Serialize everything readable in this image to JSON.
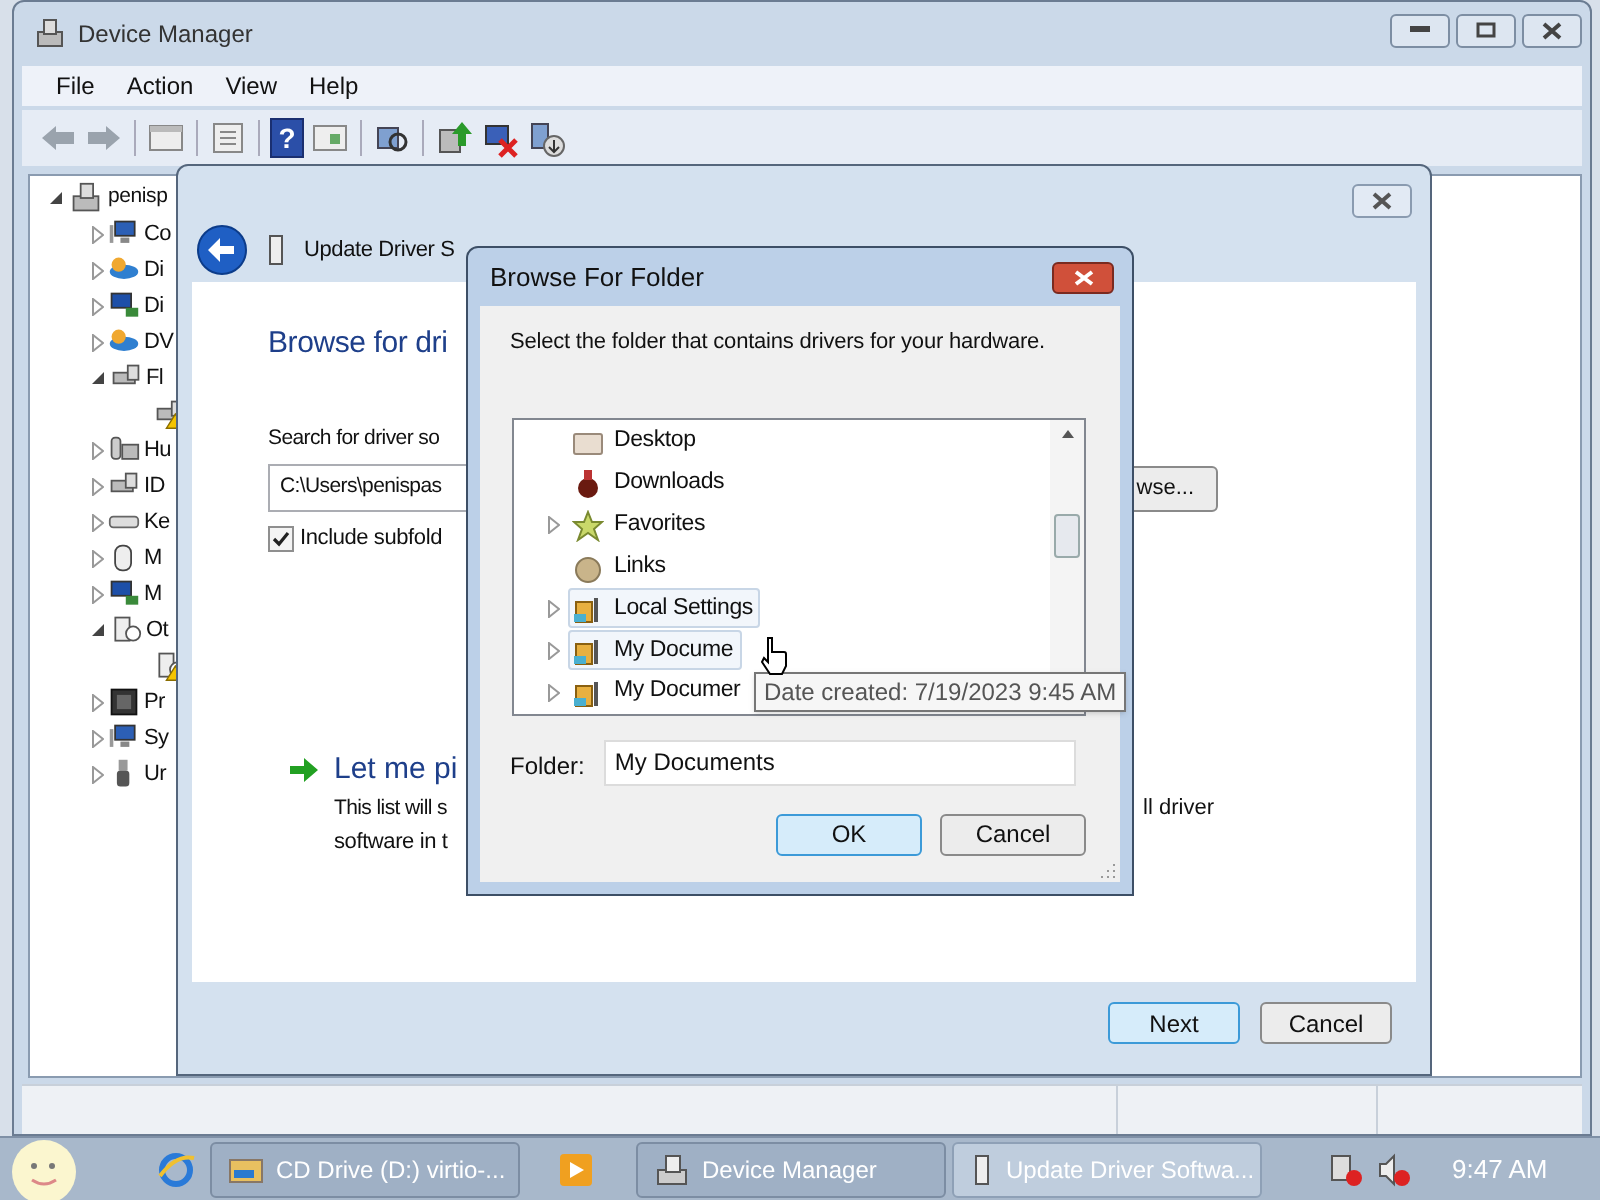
{
  "device_manager": {
    "title": "Device Manager",
    "menu": [
      "File",
      "Action",
      "View",
      "Help"
    ],
    "help_glyph": "?",
    "tree": {
      "label": "penisp",
      "expanded": true,
      "children": [
        {
          "label": "Co",
          "kind": "computer",
          "expanded": false
        },
        {
          "label": "Di",
          "kind": "drive",
          "expanded": false
        },
        {
          "label": "Di",
          "kind": "display",
          "expanded": false
        },
        {
          "label": "DV",
          "kind": "drive",
          "expanded": false
        },
        {
          "label": "Fl",
          "kind": "adapter",
          "expanded": true,
          "children": [
            {
              "kind": "adapter",
              "warning": true
            }
          ]
        },
        {
          "label": "Hu",
          "kind": "hid",
          "expanded": false
        },
        {
          "label": "ID",
          "kind": "adapter",
          "expanded": false
        },
        {
          "label": "Ke",
          "kind": "keyboard",
          "expanded": false
        },
        {
          "label": "M",
          "kind": "mouse",
          "expanded": false
        },
        {
          "label": "M",
          "kind": "display",
          "expanded": false
        },
        {
          "label": "Ot",
          "kind": "unknown",
          "expanded": true,
          "children": [
            {
              "kind": "unknown",
              "warning": true
            }
          ]
        },
        {
          "label": "Pr",
          "kind": "chip",
          "expanded": false
        },
        {
          "label": "Sy",
          "kind": "computer",
          "expanded": false
        },
        {
          "label": "Ur",
          "kind": "usb",
          "expanded": false
        }
      ]
    }
  },
  "update_driver": {
    "title": "Update Driver S",
    "heading": "Browse for dri",
    "search_label": "Search for driver so",
    "path": "C:\\Users\\penispas",
    "browse_button": "wse...",
    "include_subfolders": {
      "label": "Include subfold",
      "checked": true
    },
    "option": {
      "title": "Let me pi",
      "line_1": "This list will s",
      "line_1_end": "ll driver",
      "line_2": "software in t"
    },
    "buttons": [
      {
        "label": "Next",
        "default": true
      },
      {
        "label": "Cancel",
        "default": false
      }
    ]
  },
  "browse_dialog": {
    "title": "Browse For Folder",
    "prompt": "Select the folder that contains drivers for your hardware.",
    "folders": [
      {
        "label": "Desktop",
        "kind": "desktop",
        "expandable": false,
        "highlighted": false
      },
      {
        "label": "Downloads",
        "kind": "downloads",
        "expandable": false,
        "highlighted": false
      },
      {
        "label": "Favorites",
        "kind": "star",
        "expandable": true,
        "highlighted": false
      },
      {
        "label": "Links",
        "kind": "links",
        "expandable": false,
        "highlighted": false
      },
      {
        "label": "Local Settings",
        "kind": "user",
        "expandable": true,
        "highlighted": true
      },
      {
        "label": "My Docume",
        "kind": "user",
        "expandable": true,
        "highlighted": true
      },
      {
        "label": "My Documer",
        "kind": "user",
        "expandable": true,
        "highlighted": false
      }
    ],
    "tooltip": "Date created: 7/19/2023 9:45 AM",
    "folder_label": "Folder:",
    "folder_value": "My Documents",
    "buttons": [
      {
        "label": "OK",
        "default": true
      },
      {
        "label": "Cancel",
        "default": false
      }
    ]
  },
  "taskbar": {
    "tasks": [
      {
        "label": "CD Drive (D:) virtio-...",
        "kind": "folder",
        "active": false
      },
      {
        "label": "Device Manager",
        "kind": "devmgr",
        "active": false
      },
      {
        "label": "Update Driver Softwa...",
        "kind": "driver",
        "active": true
      }
    ],
    "clock": "9:47 AM"
  }
}
